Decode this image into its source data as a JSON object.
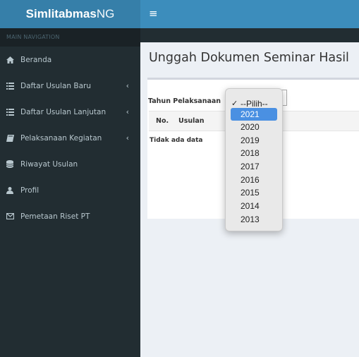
{
  "brand": {
    "bold": "Simlitabmas",
    "light": "NG"
  },
  "sidebar": {
    "header": "MAIN NAVIGATION",
    "items": [
      {
        "label": "Beranda",
        "icon": "home-icon",
        "chevron": ""
      },
      {
        "label": "Daftar Usulan Baru",
        "icon": "list-icon",
        "chevron": "‹"
      },
      {
        "label": "Daftar Usulan Lanjutan",
        "icon": "list-icon",
        "chevron": "‹"
      },
      {
        "label": "Pelaksanaan Kegiatan",
        "icon": "book-icon",
        "chevron": "‹"
      },
      {
        "label": "Riwayat Usulan",
        "icon": "database-icon",
        "chevron": ""
      },
      {
        "label": "Profil",
        "icon": "user-icon",
        "chevron": ""
      },
      {
        "label": "Pemetaan Riset PT",
        "icon": "envelope-icon",
        "chevron": ""
      }
    ]
  },
  "topbar": {
    "menu_glyph": "≡"
  },
  "page": {
    "title": "Unggah Dokumen Seminar Hasil",
    "filter_label": "Tahun Pelaksanaan",
    "table": {
      "col_no": "No.",
      "col_usulan": "Usulan",
      "empty": "Tidak ada data"
    }
  },
  "dropdown": {
    "checked_option": "--Pilih--",
    "highlighted_option": "2021",
    "options": [
      "--Pilih--",
      "2021",
      "2020",
      "2019",
      "2018",
      "2017",
      "2016",
      "2015",
      "2014",
      "2013"
    ]
  },
  "colors": {
    "topbar": "#3c8dbc",
    "logo_bg": "#367fa9",
    "sidebar": "#222d32",
    "highlight": "#4a90e2"
  }
}
